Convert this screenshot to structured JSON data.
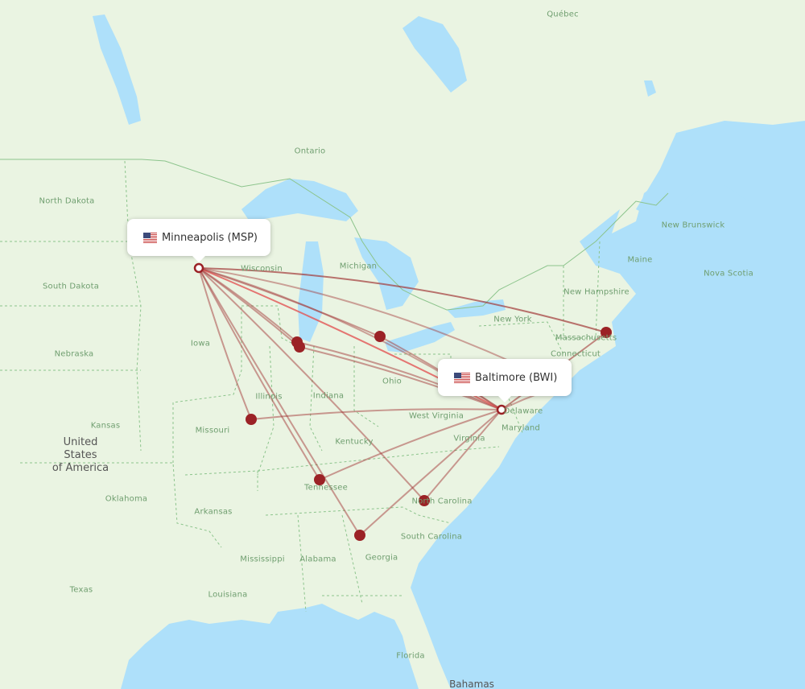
{
  "map": {
    "colors": {
      "land": "#eaf4e2",
      "water": "#aee0fa",
      "route_line": "#a33a3a",
      "route_highlight": "#e25555",
      "marker": "#9b2226",
      "border": "#8cc48c",
      "label": "#6f9e6f"
    },
    "origin": {
      "city": "Minneapolis",
      "code": "MSP",
      "label": "Minneapolis (MSP)",
      "flag": "us-flag-icon"
    },
    "destination": {
      "city": "Baltimore",
      "code": "BWI",
      "label": "Baltimore (BWI)",
      "flag": "us-flag-icon"
    },
    "connection_stops": [
      {
        "name": "Boston area"
      },
      {
        "name": "Chicago area (1)"
      },
      {
        "name": "Chicago area (2)"
      },
      {
        "name": "Detroit area"
      },
      {
        "name": "St. Louis area"
      },
      {
        "name": "Nashville area"
      },
      {
        "name": "Charlotte area"
      },
      {
        "name": "Atlanta area"
      }
    ],
    "region_labels": [
      "Québec",
      "Ontario",
      "North Dakota",
      "South Dakota",
      "Wisconsin",
      "Michigan",
      "Iowa",
      "Nebraska",
      "Kansas",
      "Illinois",
      "Indiana",
      "Ohio",
      "Missouri",
      "Kentucky",
      "West Virginia",
      "Virginia",
      "Tennessee",
      "North Carolina",
      "South Carolina",
      "Georgia",
      "Alabama",
      "Mississippi",
      "Arkansas",
      "Oklahoma",
      "Texas",
      "Louisiana",
      "Florida",
      "New York",
      "Massachusetts",
      "Connecticut",
      "New Hampshire",
      "Maine",
      "New Brunswick",
      "Nova Scotia",
      "Delaware",
      "Maryland"
    ],
    "country_label": "United\nStates\nof America",
    "bahamas_label": "Bahamas"
  }
}
